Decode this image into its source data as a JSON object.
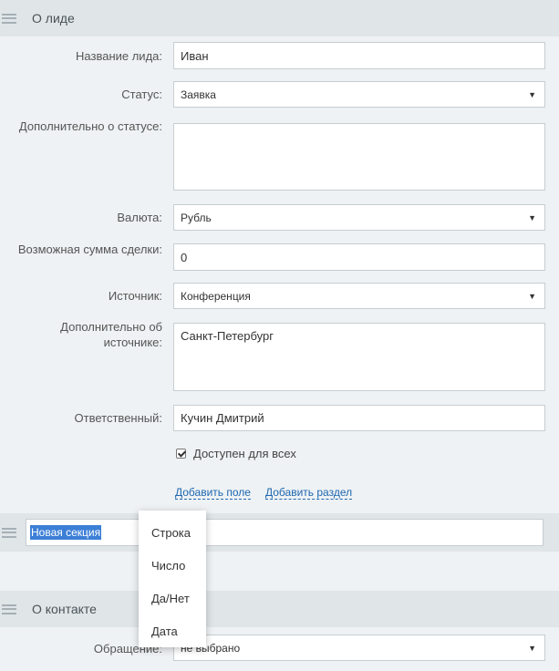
{
  "section_lead": {
    "title": "О лиде"
  },
  "fields": {
    "lead_name": {
      "label": "Название лида:",
      "value": "Иван"
    },
    "status": {
      "label": "Статус:",
      "value": "Заявка"
    },
    "status_extra": {
      "label": "Дополнительно о статусе:",
      "value": ""
    },
    "currency": {
      "label": "Валюта:",
      "value": "Рубль"
    },
    "deal_sum": {
      "label": "Возможная сумма сделки:",
      "value": "0"
    },
    "source": {
      "label": "Источник:",
      "value": "Конференция"
    },
    "source_extra": {
      "label": "Дополнительно об источнике:",
      "value": "Санкт-Петербург"
    },
    "responsible": {
      "label": "Ответственный:",
      "value": "Кучин Дмитрий"
    }
  },
  "available_all": {
    "label": "Доступен для всех",
    "checked": true
  },
  "links": {
    "add_field": "Добавить поле",
    "add_section": "Добавить раздел"
  },
  "new_section": {
    "value": "Новая секция"
  },
  "popup": {
    "items": [
      "Строка",
      "Число",
      "Да/Нет",
      "Дата"
    ]
  },
  "section_contact": {
    "title": "О контакте"
  },
  "contact_fields": {
    "address": {
      "label": "Обращение:",
      "value": "не выбрано"
    }
  },
  "icons": {
    "drag": "drag-handle-icon",
    "dropdown": "chevron-down-icon",
    "check": "checkmark-icon"
  },
  "colors": {
    "link": "#2067b0",
    "selection": "#3c7fd6",
    "header": "#e0e5e8",
    "background": "#eef2f4"
  }
}
